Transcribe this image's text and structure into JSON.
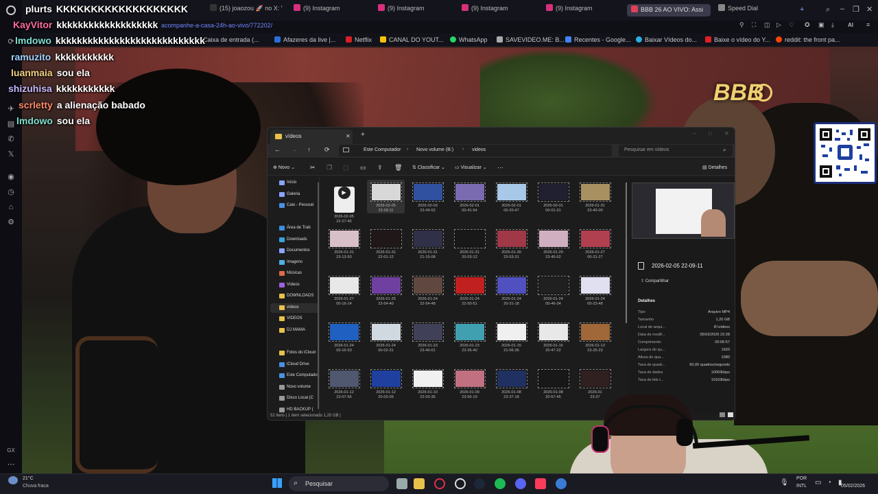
{
  "browser": {
    "tabs": [
      {
        "label": "(15) joaozou 🚀 no X: \"s"
      },
      {
        "label": "(9) Instagram"
      },
      {
        "label": "(9) Instagram"
      },
      {
        "label": "(9) Instagram"
      },
      {
        "label": "(9) Instagram"
      },
      {
        "label": "BBB 26 AO VIVO: Assi"
      },
      {
        "label": "Speed Dial"
      }
    ],
    "address": "acompanhe-a-casa-24h-ao-vivo/772202/",
    "bookmarks": [
      {
        "label": "Caixa de entrada (..."
      },
      {
        "label": "Afazeres da live |..."
      },
      {
        "label": "Netflix"
      },
      {
        "label": "CANAL DO YOUT..."
      },
      {
        "label": "WhatsApp"
      },
      {
        "label": "SAVEVIDEO.ME: B..."
      },
      {
        "label": "Recentes - Google..."
      },
      {
        "label": "Baixar Vídeos do..."
      },
      {
        "label": "Baixe o vídeo do Y..."
      },
      {
        "label": "reddit: the front pa..."
      }
    ],
    "ai_label": "AI",
    "side_label": "GX"
  },
  "chat": [
    {
      "user": "plurts",
      "color": "#ffffff",
      "message": "KKKKKKKKKKKKKKKKKKK"
    },
    {
      "user": "KayVitor",
      "color": "#ff6b9e",
      "message": "kkkkkkkkkkkkkkkkkkk"
    },
    {
      "user": "lmdowo",
      "color": "#7fe0d0",
      "message": "kkkkkkkkkkkkkkkkkkkkkkkkkkkk"
    },
    {
      "user": "ramuzito",
      "color": "#9fd2ff",
      "message": "kkkkkkkkkkk"
    },
    {
      "user": "luanmaia",
      "color": "#f0d080",
      "message": "sou ela"
    },
    {
      "user": "shizuhisa",
      "color": "#c7b8ff",
      "message": "kkkkkkkkkkk"
    },
    {
      "user": "scrletty",
      "color": "#ff8a6b",
      "message": "a alienação babado"
    },
    {
      "user": "lmdowo",
      "color": "#7fe0d0",
      "message": "sou ela"
    }
  ],
  "overlay": {
    "bbb_logo": "BBB"
  },
  "explorer": {
    "tab_title": "vídeos",
    "breadcrumb": [
      "Este Computador",
      "Novo volume (B:)",
      "videos"
    ],
    "search_placeholder": "Pesquisar em vídeos",
    "commands": {
      "new": "Novo",
      "sort": "Classificar",
      "view": "Visualizar",
      "details": "Detalhes"
    },
    "nav": [
      {
        "label": "Início",
        "color": "#8aa4ff"
      },
      {
        "label": "Galeria",
        "color": "#8aa4ff"
      },
      {
        "label": "Caio - Pessoal",
        "color": "#4a90e2"
      },
      {
        "label": "Área de Trab",
        "color": "#3c8de0"
      },
      {
        "label": "Downloads",
        "color": "#3aa0e0"
      },
      {
        "label": "Documentos",
        "color": "#8aa4ff"
      },
      {
        "label": "Imagens",
        "color": "#4fb0e8"
      },
      {
        "label": "Músicas",
        "color": "#e06a4a"
      },
      {
        "label": "Vídeos",
        "color": "#a060e0"
      },
      {
        "label": "DOWNLOADS",
        "color": "#e8c24a"
      },
      {
        "label": "vídeos",
        "color": "#e8c24a"
      },
      {
        "label": "VIDEOS",
        "color": "#e8c24a"
      },
      {
        "label": "DJ MAMA",
        "color": "#e8c24a"
      },
      {
        "label": "Fotos do iCloud",
        "color": "#e8c24a"
      },
      {
        "label": "iCloud Drive",
        "color": "#4a90e2"
      },
      {
        "label": "Este Computador",
        "color": "#4a90e2"
      },
      {
        "label": "Novo volume",
        "color": "#999999"
      },
      {
        "label": "Disco Local (C",
        "color": "#999999"
      },
      {
        "label": "HD BACKUP (",
        "color": "#999999"
      }
    ],
    "files": [
      {
        "date": "2026-02-05",
        "time": "22-27-45",
        "color": "#eeeeee"
      },
      {
        "date": "2026-02-05",
        "time": "22-09-11",
        "color": "#d8d8d8"
      },
      {
        "date": "2026-02-03",
        "time": "23-49-52",
        "color": "#3050a0"
      },
      {
        "date": "2026-02-01",
        "time": "00-41-54",
        "color": "#7a6ab0"
      },
      {
        "date": "2026-02-01",
        "time": "00-20-47",
        "color": "#a8c8e8"
      },
      {
        "date": "2026-02-01",
        "time": "00-01-31",
        "color": "#202030"
      },
      {
        "date": "2026-01-31",
        "time": "23-40-00",
        "color": "#a89060"
      },
      {
        "date": "2026-01-31",
        "time": "23-13-50",
        "color": "#d8c0c8"
      },
      {
        "date": "2026-01-31",
        "time": "22-01-12",
        "color": "#201818"
      },
      {
        "date": "2026-01-31",
        "time": "21-15-08",
        "color": "#303048"
      },
      {
        "date": "2026-01-31",
        "time": "20-53-12",
        "color": "#181818"
      },
      {
        "date": "2026-01-30",
        "time": "23-53-31",
        "color": "#a03848"
      },
      {
        "date": "2026-01-29",
        "time": "23-45-02",
        "color": "#d0b0c0"
      },
      {
        "date": "2026-01-27",
        "time": "00-31-27",
        "color": "#b04050"
      },
      {
        "date": "2026-01-27",
        "time": "00-16-14",
        "color": "#e8e8e8"
      },
      {
        "date": "2026-01-25",
        "time": "23-54-40",
        "color": "#7040a0"
      },
      {
        "date": "2026-01-24",
        "time": "22-54-48",
        "color": "#604840"
      },
      {
        "date": "2026-01-24",
        "time": "22-50-51",
        "color": "#c02020"
      },
      {
        "date": "2026-01-24",
        "time": "20-31-18",
        "color": "#5050c0"
      },
      {
        "date": "2026-01-24",
        "time": "00-46-34",
        "color": "#202020"
      },
      {
        "date": "2026-01-24",
        "time": "00-23-48",
        "color": "#e0e0f0"
      },
      {
        "date": "2026-01-24",
        "time": "00-16-53",
        "color": "#2060c0"
      },
      {
        "date": "2026-01-24",
        "time": "00-02-31",
        "color": "#d0d8e0"
      },
      {
        "date": "2026-01-23",
        "time": "23-40-01",
        "color": "#404058"
      },
      {
        "date": "2026-01-23",
        "time": "23-36-40",
        "color": "#40a0b0"
      },
      {
        "date": "2026-01-15",
        "time": "21-06-36",
        "color": "#f0f0f0"
      },
      {
        "date": "2026-01-15",
        "time": "20-47-22",
        "color": "#e8e8e8"
      },
      {
        "date": "2026-01-13",
        "time": "23-25-23",
        "color": "#a06838"
      },
      {
        "date": "2026-01-12",
        "time": "23-07-56",
        "color": "#505870"
      },
      {
        "date": "2026-01-12",
        "time": "20-03-09",
        "color": "#2040a0"
      },
      {
        "date": "2026-01-10",
        "time": "22-03-36",
        "color": "#f0f0f0"
      },
      {
        "date": "2026-01-09",
        "time": "23-56-19",
        "color": "#c07080"
      },
      {
        "date": "2026-01-08",
        "time": "23-37-18",
        "color": "#203060"
      },
      {
        "date": "2026-01-08",
        "time": "20-57-45",
        "color": "#181818"
      },
      {
        "date": "2026-01",
        "time": "23-37",
        "color": "#302020"
      }
    ],
    "details": {
      "filename": "2026-02-05 22-09-11",
      "share": "Compartilhar",
      "section": "Detalhes",
      "props": [
        {
          "k": "Tipo",
          "v": "Arquivo MP4"
        },
        {
          "k": "Tamanho",
          "v": "1,20 GB"
        },
        {
          "k": "Local do arqui...",
          "v": "B:\\videos"
        },
        {
          "k": "Data de modif...",
          "v": "05/02/2026 22:28"
        },
        {
          "k": "Comprimento",
          "v": "00:06:57"
        },
        {
          "k": "Largura do qu...",
          "v": "1920"
        },
        {
          "k": "Altura do qua...",
          "v": "1080"
        },
        {
          "k": "Taxa de quadr...",
          "v": "60,00 quadros/segundo"
        },
        {
          "k": "Taxa de dados",
          "v": "10003kbps"
        },
        {
          "k": "Taxa de bits t...",
          "v": "10163kbps"
        }
      ]
    },
    "status": "52 itens  |  1 item selecionado  1,20 GB  |"
  },
  "taskbar": {
    "weather_temp": "21°C",
    "weather_desc": "Chuva fraca",
    "search": "Pesquisar",
    "lang1": "POR",
    "lang2": "INTL",
    "date": "05/02/2026"
  }
}
